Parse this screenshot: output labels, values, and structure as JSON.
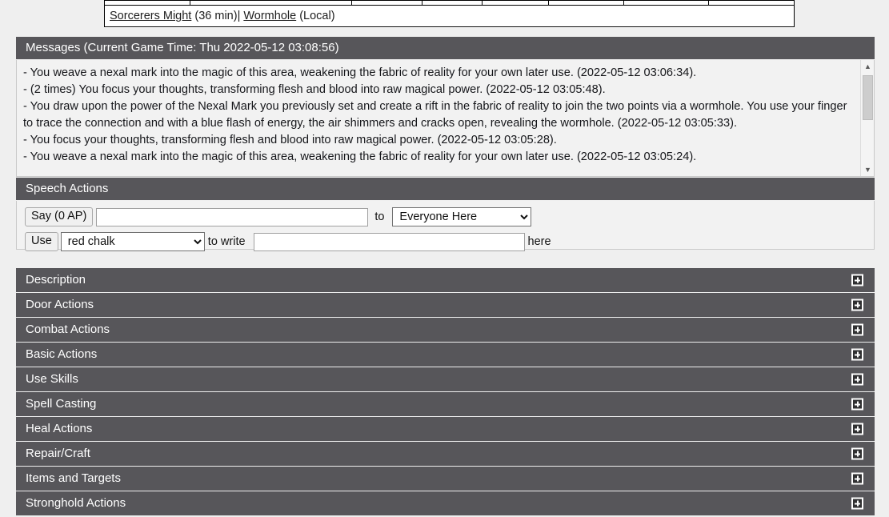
{
  "status_table": {
    "top_row_cells": [
      "",
      "",
      "",
      "",
      "",
      "",
      "",
      ""
    ],
    "effects_row": {
      "effects": [
        {
          "name": "Sorcerers Might",
          "duration": "(36 min)"
        },
        {
          "name": "Wormhole",
          "duration": "(Local)"
        }
      ],
      "separator": "| "
    }
  },
  "messages": {
    "header": "Messages (Current Game Time: Thu 2022-05-12 03:08:56)",
    "lines": [
      "- You weave a nexal mark into the magic of this area, weakening the fabric of reality for your own later use. (2022-05-12 03:06:34).",
      "- (2 times) You focus your thoughts, transforming flesh and blood into raw magical power. (2022-05-12 03:05:48).",
      "- You draw upon the power of the Nexal Mark you previously set and create a rift in the fabric of reality to join the two points via a wormhole. You use your finger to trace the connection and with a blue flash of energy, the air shimmers and cracks open, revealing the wormhole. (2022-05-12 03:05:33).",
      "- You focus your thoughts, transforming flesh and blood into raw magical power. (2022-05-12 03:05:28).",
      "- You weave a nexal mark into the magic of this area, weakening the fabric of reality for your own later use. (2022-05-12 03:05:24)."
    ],
    "scroll_up_icon": "chevron-up-icon",
    "scroll_down_icon": "chevron-down-icon"
  },
  "speech_actions": {
    "header": "Speech Actions",
    "say_button": "Say (0 AP)",
    "say_value": "",
    "say_placeholder": "",
    "to_label": "to",
    "say_target_selected": "Everyone Here",
    "say_target_options": [
      "Everyone Here"
    ],
    "use_button": "Use",
    "use_item_selected": "red chalk",
    "use_item_options": [
      "red chalk"
    ],
    "to_write_label": "to write",
    "write_value": "",
    "write_placeholder": "",
    "here_label": "here"
  },
  "sections": [
    {
      "label": "Description",
      "icon": "expand-plus-icon"
    },
    {
      "label": "Door Actions",
      "icon": "expand-plus-icon"
    },
    {
      "label": "Combat Actions",
      "icon": "expand-plus-icon"
    },
    {
      "label": "Basic Actions",
      "icon": "expand-plus-icon"
    },
    {
      "label": "Use Skills",
      "icon": "expand-plus-icon"
    },
    {
      "label": "Spell Casting",
      "icon": "expand-plus-icon"
    },
    {
      "label": "Heal Actions",
      "icon": "expand-plus-icon"
    },
    {
      "label": "Repair/Craft",
      "icon": "expand-plus-icon"
    },
    {
      "label": "Items and Targets",
      "icon": "expand-plus-icon"
    },
    {
      "label": "Stronghold Actions",
      "icon": "expand-plus-icon"
    }
  ],
  "colors": {
    "panel_header_bg": "#57565a",
    "page_bg": "#efefef",
    "panel_body_bg": "#f2f2f2",
    "text": "#15161a",
    "header_text": "#ffffff"
  }
}
